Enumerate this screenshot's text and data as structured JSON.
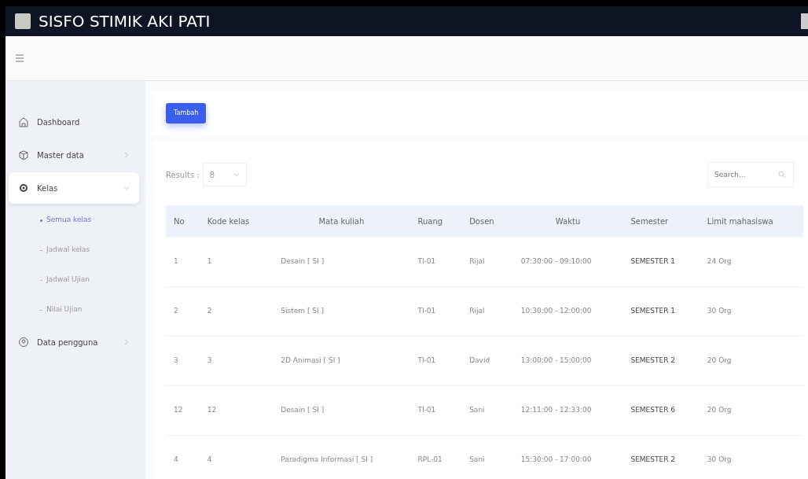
{
  "app": {
    "title": "SISFO STIMIK AKI PATI"
  },
  "sidebar": {
    "items": [
      {
        "label": "Dashboard",
        "selected": false
      },
      {
        "label": "Master data",
        "expanded": false,
        "selected": false
      },
      {
        "label": "Kelas",
        "expanded": true,
        "selected": true,
        "children": [
          {
            "label": "Semua kelas",
            "selected": true
          },
          {
            "label": "Jadwal kelas",
            "selected": false
          },
          {
            "label": "Jadwal Ujian",
            "selected": false
          },
          {
            "label": "Nilai Ujian",
            "selected": false
          }
        ]
      },
      {
        "label": "Data pengguna",
        "expanded": false,
        "selected": false
      }
    ]
  },
  "toolbar": {
    "buttons": [
      "Tambah"
    ]
  },
  "table_controls": {
    "results_label": "Results :",
    "results_value": "8",
    "search_placeholder": "Search..."
  },
  "table": {
    "columns": [
      "No",
      "Kode kelas",
      "Mata kuliah",
      "Ruang",
      "Dosen",
      "Waktu",
      "Semester",
      "Limit mahasiswa"
    ],
    "rows": [
      [
        "1",
        "1",
        "Desain [ SI ]",
        "TI-01",
        "Rijal",
        "07:30:00 - 09:10:00",
        "SEMESTER 1",
        "24 Org"
      ],
      [
        "2",
        "2",
        "Sistem [ SI ]",
        "TI-01",
        "Rijal",
        "10:30:00 - 12:00:00",
        "SEMESTER 1",
        "30 Org"
      ],
      [
        "3",
        "3",
        "2D Animasi [ SI ]",
        "TI-01",
        "David",
        "13:00:00 - 15:00:00",
        "SEMESTER 2",
        "20 Org"
      ],
      [
        "12",
        "12",
        "Desain [ SI ]",
        "TI-01",
        "Sani",
        "12:11:00 - 12:33:00",
        "SEMESTER 6",
        "20 Org"
      ],
      [
        "4",
        "4",
        "Paradigma Informasi [ SI ]",
        "RPL-01",
        "Sani",
        "15:30:00 - 17:00:00",
        "SEMESTER 2",
        "30 Org"
      ]
    ]
  }
}
